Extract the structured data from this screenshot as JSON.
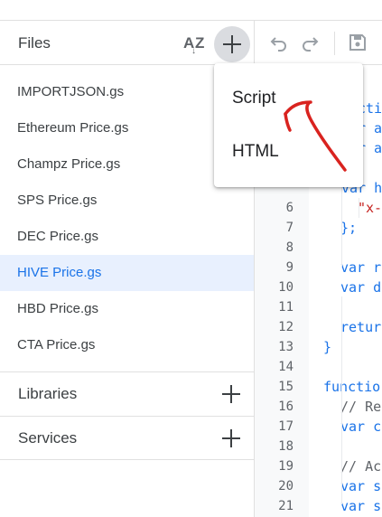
{
  "files_panel": {
    "title": "Files",
    "sort_icon": "az-sort-icon",
    "add_icon": "plus-icon",
    "files": [
      {
        "name": "IMPORTJSON.gs",
        "active": false
      },
      {
        "name": "Ethereum Price.gs",
        "active": false
      },
      {
        "name": "Champz Price.gs",
        "active": false
      },
      {
        "name": "SPS Price.gs",
        "active": false
      },
      {
        "name": "DEC Price.gs",
        "active": false
      },
      {
        "name": "HIVE Price.gs",
        "active": true
      },
      {
        "name": "HBD Price.gs",
        "active": false
      },
      {
        "name": "CTA Price.gs",
        "active": false
      }
    ],
    "libraries_label": "Libraries",
    "services_label": "Services"
  },
  "add_menu": {
    "items": [
      "Script",
      "HTML"
    ]
  },
  "editor": {
    "toolbar_icons": [
      "undo-icon",
      "redo-icon",
      "save-icon"
    ],
    "lines": [
      {
        "n": "6",
        "text": "\"x-",
        "kind": "str",
        "indent": 2
      },
      {
        "n": "7",
        "text": "};",
        "kind": "code",
        "indent": 1
      },
      {
        "n": "8",
        "text": "",
        "kind": "code",
        "indent": 1
      },
      {
        "n": "9",
        "text": "var r",
        "kind": "code",
        "indent": 1
      },
      {
        "n": "10",
        "text": "var d",
        "kind": "code",
        "indent": 1
      },
      {
        "n": "11",
        "text": "",
        "kind": "code",
        "indent": 1
      },
      {
        "n": "12",
        "text": "retur",
        "kind": "code",
        "indent": 1
      },
      {
        "n": "13",
        "text": "}",
        "kind": "code",
        "indent": 0
      },
      {
        "n": "14",
        "text": "",
        "kind": "code",
        "indent": 0
      },
      {
        "n": "15",
        "text": "functio",
        "kind": "code",
        "indent": 0
      },
      {
        "n": "16",
        "text": "// Re",
        "kind": "cmt",
        "indent": 1
      },
      {
        "n": "17",
        "text": "var c",
        "kind": "code",
        "indent": 1
      },
      {
        "n": "18",
        "text": "",
        "kind": "code",
        "indent": 1
      },
      {
        "n": "19",
        "text": "// Ac",
        "kind": "cmt",
        "indent": 1
      },
      {
        "n": "20",
        "text": "var s",
        "kind": "code",
        "indent": 1
      },
      {
        "n": "21",
        "text": "var s",
        "kind": "code",
        "indent": 1
      }
    ],
    "hidden_top_lines": [
      {
        "text": "ctio",
        "kind": "code"
      },
      {
        "text": "r a",
        "kind": "code"
      },
      {
        "text": "r a",
        "kind": "code"
      },
      {
        "text": "",
        "kind": "code"
      },
      {
        "text": "var h",
        "kind": "code"
      }
    ]
  },
  "colors": {
    "accent": "#1a73e8",
    "active_bg": "#e8f0fe",
    "annotation": "#d9231f"
  }
}
